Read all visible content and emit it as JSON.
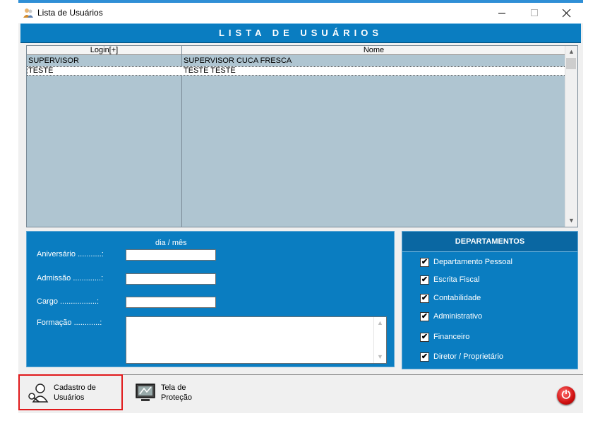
{
  "window": {
    "title": "Lista de Usuários",
    "minimize": "—",
    "maximize": "☐",
    "close": "✕"
  },
  "banner": {
    "title": "LISTA DE USUÁRIOS"
  },
  "grid": {
    "columns": [
      "Login[+]",
      "Nome"
    ],
    "rows": [
      {
        "login": "SUPERVISOR",
        "nome": "SUPERVISOR CUCA FRESCA"
      },
      {
        "login": "TESTE",
        "nome": "TESTE TESTE"
      }
    ],
    "scroll_up": "▲",
    "scroll_down": "▼"
  },
  "details": {
    "date_hint": "dia / mês",
    "aniversario_label": "Aniversário ...........:",
    "admissao_label": "Admissão .............:",
    "cargo_label": "Cargo .................:",
    "formacao_label": "Formação ............:",
    "aniversario_value": "",
    "admissao_value": "",
    "cargo_value": "",
    "formacao_value": ""
  },
  "departments": {
    "title": "DEPARTAMENTOS",
    "items": [
      {
        "label": "Departamento Pessoal",
        "checked": true
      },
      {
        "label": "Escrita Fiscal",
        "checked": true
      },
      {
        "label": "Contabilidade",
        "checked": true
      },
      {
        "label": "Administrativo",
        "checked": true
      },
      {
        "label": "Financeiro",
        "checked": true
      },
      {
        "label": "Diretor / Proprietário",
        "checked": true
      }
    ],
    "check_mark": "✔"
  },
  "toolbar": {
    "cadastro_label": "Cadastro de Usuários",
    "protecao_label": "Tela de Proteção",
    "power_symbol": "⏻"
  },
  "colors": {
    "accent": "#0a7dc1",
    "grid_bg": "#afc5d1",
    "highlight": "#e0191b"
  },
  "icons": [
    "users-icon",
    "keys-users-icon",
    "monitor-icon",
    "power-icon"
  ]
}
